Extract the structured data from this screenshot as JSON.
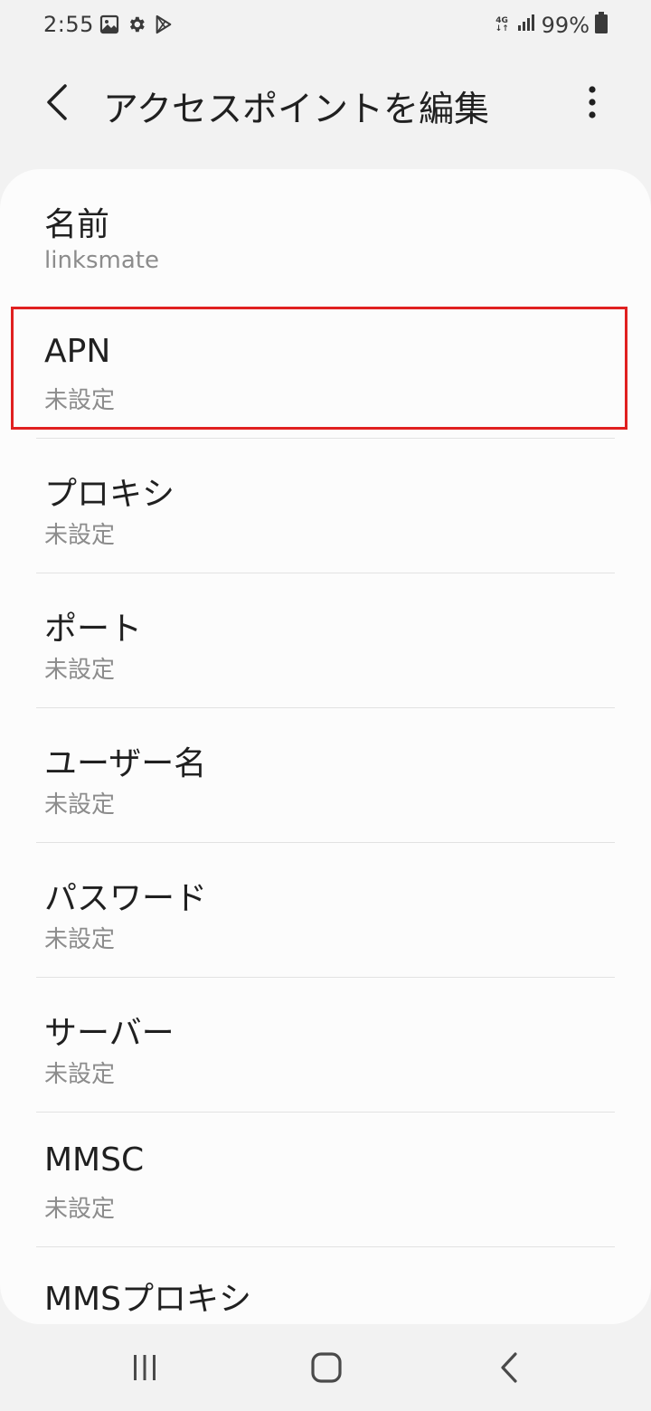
{
  "status_bar": {
    "time": "2:55",
    "battery": "99%",
    "network_top": "4G",
    "network_bottom": "↓↑",
    "icons": [
      "image-icon",
      "gear-icon",
      "play-store-icon",
      "signal-icon",
      "battery-icon"
    ]
  },
  "app_bar": {
    "title": "アクセスポイントを編集",
    "back_icon": "chevron-left-icon",
    "more_icon": "more-vertical-icon"
  },
  "fields": [
    {
      "label": "名前",
      "value": "linksmate"
    },
    {
      "label": "APN",
      "value": "未設定"
    },
    {
      "label": "プロキシ",
      "value": "未設定"
    },
    {
      "label": "ポート",
      "value": "未設定"
    },
    {
      "label": "ユーザー名",
      "value": "未設定"
    },
    {
      "label": "パスワード",
      "value": "未設定"
    },
    {
      "label": "サーバー",
      "value": "未設定"
    },
    {
      "label": "MMSC",
      "value": "未設定"
    },
    {
      "label": "MMSプロキシ",
      "value": ""
    }
  ],
  "highlight": {
    "color": "#e02020",
    "target_field": "APN"
  },
  "nav_bar": {
    "icons": [
      "recent-apps-icon",
      "home-icon",
      "back-icon"
    ]
  },
  "colors": {
    "background": "#f2f2f2",
    "card": "#fcfcfc",
    "primary_text": "#202020",
    "secondary_text": "#8c8c8c"
  }
}
